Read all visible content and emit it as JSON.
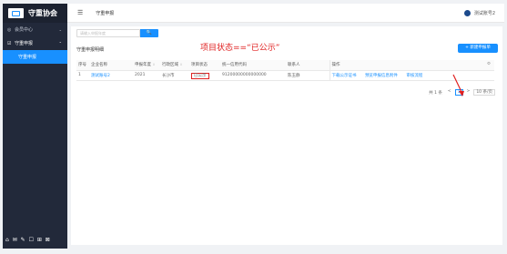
{
  "app": {
    "name": "守重协会"
  },
  "sidebar": {
    "items": [
      {
        "label": "会员中心",
        "icon": "circle-check-icon"
      },
      {
        "label": "守重申报",
        "icon": "edit-icon"
      },
      {
        "label": "守重申报"
      }
    ],
    "bottom_icons": "⌂ ✉ ✎ ☐ ⊞ ⊠"
  },
  "header": {
    "breadcrumb": "守重申报",
    "user": "测试账号2"
  },
  "toolbar": {
    "search_placeholder": "请输入申报年度",
    "search_label": "🔍",
    "new_label": "+ 新建申报单"
  },
  "annotation": "项目状态==“已公示”",
  "section_title": "守重申报明细",
  "table": {
    "headers": [
      "序号",
      "企业名称",
      "申报年度",
      "行政区域",
      "项目状态",
      "统一信用代码",
      "联系人",
      "操作"
    ],
    "rows": [
      {
        "no": "1",
        "name": "测试账号2",
        "year": "2021",
        "region": "长沙市",
        "status": "已公示",
        "code": "91200000000000000",
        "contact": "陈玉静",
        "actions": [
          "下载公示证书",
          "预览申报信息附件",
          "审核流程"
        ]
      }
    ]
  },
  "pager": {
    "total": "共 1 条",
    "prev": "<",
    "current": "1",
    "next": ">",
    "size": "10 条/页"
  },
  "colors": {
    "accent": "#1890ff",
    "sidebar_bg": "#22293a",
    "annotation": "#e02020"
  }
}
